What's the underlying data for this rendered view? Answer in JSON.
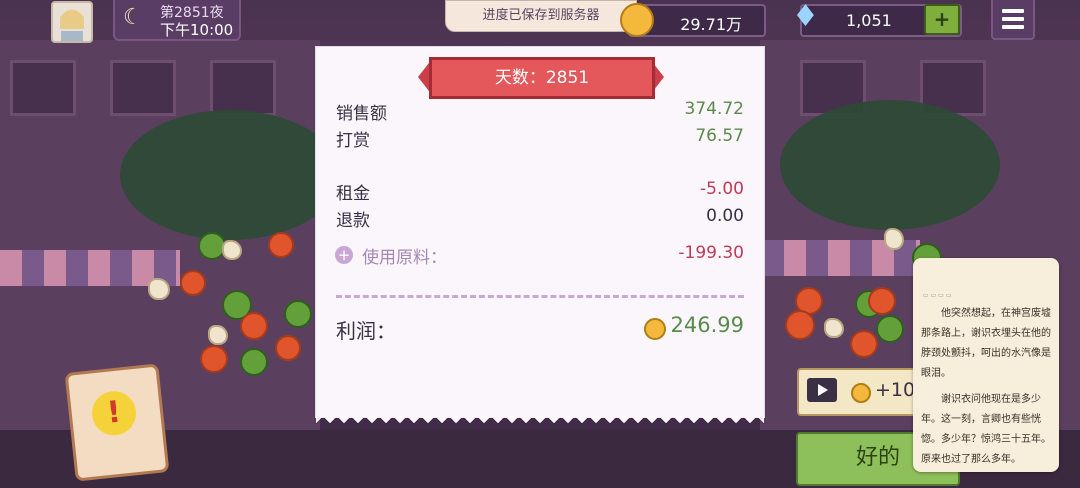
{
  "hud": {
    "night_label": "第2851夜",
    "time": "下午10:00",
    "toast": "进度已保存到服务器",
    "coins": "29.71万",
    "gems": "1,051",
    "add_label": "+"
  },
  "receipt": {
    "title": "天数：2851",
    "rows": [
      {
        "label": "销售额",
        "value": "374.72"
      },
      {
        "label": "打赏",
        "value": "76.57"
      },
      {
        "label": "租金",
        "value": "-5.00"
      },
      {
        "label": "退款",
        "value": "0.00"
      },
      {
        "label": "使用原料：",
        "value": "-199.30"
      }
    ],
    "profit_label": "利润：",
    "profit_value": "246.99"
  },
  "video_reward": {
    "label": "+10"
  },
  "ok_button": {
    "label": "好的"
  },
  "reader": {
    "paragraphs": [
      "他突然想起，在神宫废墟那条路上，谢识衣埋头在他的脖颈处颤抖，呵出的水汽像是眼泪。",
      "谢识衣问他现在是多少年。这一刻，言卿也有些恍惚。多少年？惊鸿三十五年。原来也过了那么多年。"
    ]
  },
  "colors": {
    "accent_positive": "#5a8a4c",
    "accent_negative": "#c13a54",
    "ribbon": "#e4575a",
    "ok": "#8dbf5a"
  }
}
